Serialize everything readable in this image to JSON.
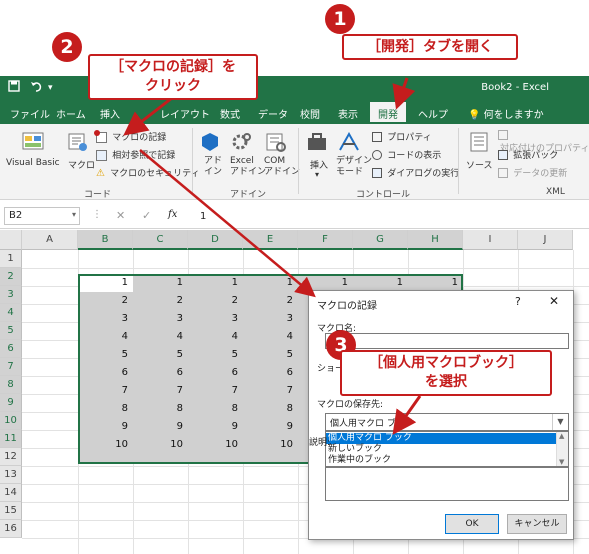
{
  "titlebar": {
    "save_icon": "save-icon",
    "undo_icon": "undo-icon",
    "doc_title": "Book2 - Excel"
  },
  "tabs": [
    {
      "label": "ファイル"
    },
    {
      "label": "ホーム"
    },
    {
      "label": "挿入"
    },
    {
      "label": "レイアウト"
    },
    {
      "label": "数式"
    },
    {
      "label": "データ"
    },
    {
      "label": "校閲"
    },
    {
      "label": "表示"
    },
    {
      "label": "開発",
      "active": true
    },
    {
      "label": "ヘルプ"
    },
    {
      "label": "何をしますか"
    }
  ],
  "ribbon": {
    "code": {
      "visual_basic": "Visual Basic",
      "macro": "マクロ",
      "record_macro": "マクロの記録",
      "relative_ref": "相対参照で記録",
      "macro_security": "マクロのセキュリティ",
      "label": "コード"
    },
    "addins": {
      "addin": "アド\nイン",
      "excel_addin": "Excel\nアドイン",
      "com_addin": "COM\nアドイン",
      "label": "アドイン"
    },
    "controls": {
      "insert": "挿入",
      "design_mode": "デザイン\nモード",
      "properties": "プロパティ",
      "view_code": "コードの表示",
      "run_dialog": "ダイアログの実行",
      "label": "コントロール"
    },
    "xml": {
      "source": "ソース",
      "map_properties": "対応付けのプロパティ",
      "expansion_packs": "拡張パック",
      "refresh_data": "データの更新",
      "label": "XML"
    }
  },
  "formula_bar": {
    "name_box": "B2",
    "fx": "fx",
    "value": "1"
  },
  "grid": {
    "columns": [
      "A",
      "B",
      "C",
      "D",
      "E",
      "F",
      "G",
      "H",
      "I",
      "J"
    ],
    "rows": [
      "1",
      "2",
      "3",
      "4",
      "5",
      "6",
      "7",
      "8",
      "9",
      "10",
      "11",
      "12",
      "13",
      "14",
      "15",
      "16"
    ],
    "values": [
      [
        "1",
        "1",
        "1",
        "1",
        "1",
        "1",
        "1"
      ],
      [
        "2",
        "2",
        "2",
        "2"
      ],
      [
        "3",
        "3",
        "3",
        "3"
      ],
      [
        "4",
        "4",
        "4",
        "4"
      ],
      [
        "5",
        "5",
        "5",
        "5"
      ],
      [
        "6",
        "6",
        "6",
        "6"
      ],
      [
        "7",
        "7",
        "7",
        "7"
      ],
      [
        "8",
        "8",
        "8",
        "8"
      ],
      [
        "9",
        "9",
        "9",
        "9"
      ],
      [
        "10",
        "10",
        "10",
        "10"
      ]
    ]
  },
  "dialog": {
    "title": "マクロの記録",
    "help": "?",
    "close": "✕",
    "macro_name_label": "マクロ名:",
    "shortcut_label": "ショートカット キー:",
    "store_label": "マクロの保存先:",
    "description_label": "説明:",
    "selected": "個人用マクロ ブック",
    "options": [
      "個人用マクロ ブック",
      "新しいブック",
      "作業中のブック"
    ],
    "ok": "OK",
    "cancel": "キャンセル"
  },
  "callouts": {
    "step1": {
      "num": "1",
      "text": "［開発］タブを開く"
    },
    "step2": {
      "num": "2",
      "line1": "［マクロの記録］を",
      "line2": "クリック"
    },
    "step3": {
      "num": "3",
      "line1": "［個人用マクロブック］",
      "line2": "を選択"
    }
  },
  "colors": {
    "excel_green": "#217346",
    "callout_red": "#c51d1d",
    "selection_blue": "#0078d7"
  }
}
